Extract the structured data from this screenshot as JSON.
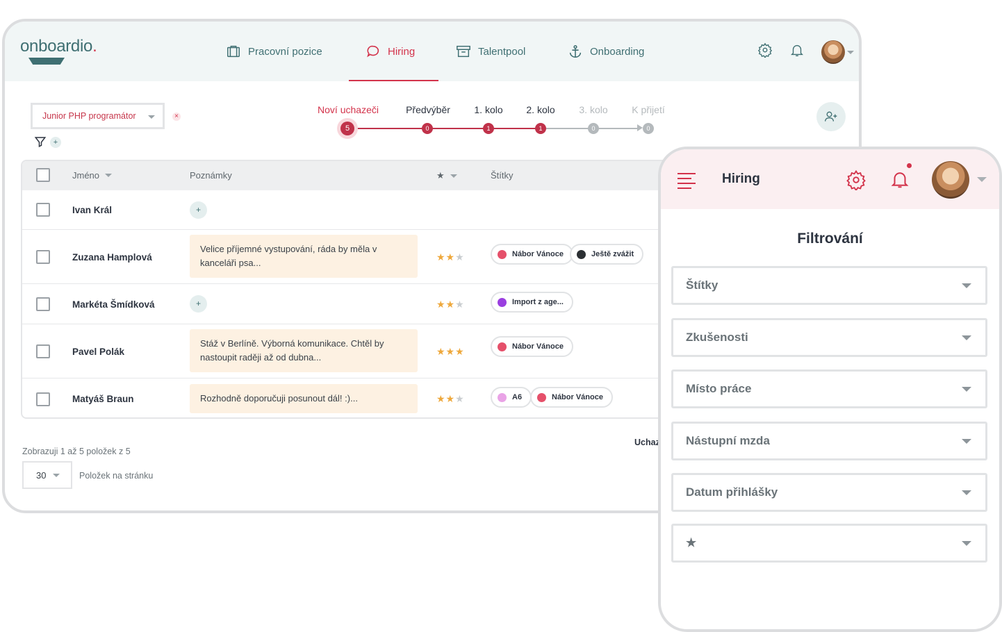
{
  "app": {
    "logo": "onboardio",
    "logo_dot": "."
  },
  "nav": [
    {
      "label": "Pracovní pozice",
      "icon": "briefcase-icon"
    },
    {
      "label": "Hiring",
      "icon": "chat-bubble-icon",
      "active": true
    },
    {
      "label": "Talentpool",
      "icon": "archive-box-icon"
    },
    {
      "label": "Onboarding",
      "icon": "anchor-icon"
    }
  ],
  "filters": {
    "job_position": "Junior PHP programátor",
    "clear": "×",
    "add": "+"
  },
  "stages": [
    {
      "label": "Noví uchazeči",
      "count": "5",
      "state": "active"
    },
    {
      "label": "Předvýběr",
      "count": "0",
      "state": "done"
    },
    {
      "label": "1. kolo",
      "count": "1",
      "state": "done"
    },
    {
      "label": "2. kolo",
      "count": "1",
      "state": "done"
    },
    {
      "label": "3. kolo",
      "count": "0",
      "state": "pending"
    },
    {
      "label": "K přijetí",
      "count": "0",
      "state": "pending"
    }
  ],
  "table": {
    "headers": {
      "name": "Jméno",
      "notes": "Poznámky",
      "rating": "★",
      "tags": "Štítky"
    },
    "rows": [
      {
        "name": "Ivan Král",
        "note": "",
        "rating": 0,
        "tags": []
      },
      {
        "name": "Zuzana Hamplová",
        "note": "Velice příjemné vystupování, ráda by měla v kanceláři psa...",
        "rating": 2,
        "tags": [
          {
            "label": "Nábor Vánoce",
            "color": "#e5506a"
          },
          {
            "label": "Ještě zvážit",
            "color": "#2b2f33"
          }
        ]
      },
      {
        "name": "Markéta Šmídková",
        "note": "",
        "rating": 2,
        "tags": [
          {
            "label": "Import z age...",
            "color": "#9a3fe0"
          }
        ]
      },
      {
        "name": "Pavel Polák",
        "note": "Stáž v Berlíně. Výborná komunikace. Chtěl by nastoupit raději až od dubna...",
        "rating": 3,
        "tags": [
          {
            "label": "Nábor Vánoce",
            "color": "#e5506a"
          }
        ]
      },
      {
        "name": "Matyáš Braun",
        "note": "Rozhodně doporučuji posunout dál! :)...",
        "rating": 2,
        "tags": [
          {
            "label": "A6",
            "color": "#e9a3e6"
          },
          {
            "label": "Nábor Vánoce",
            "color": "#e5506a"
          }
        ]
      }
    ]
  },
  "pagination": {
    "summary": "Zobrazuji 1 až 5 položek z 5",
    "per_page": "30",
    "per_page_label": "Položek na stránku",
    "side_label": "Uchaz"
  },
  "mobile": {
    "title": "Hiring",
    "heading": "Filtrování",
    "filters": [
      "Štítky",
      "Zkušenosti",
      "Místo práce",
      "Nástupní mzda",
      "Datum přihlášky",
      "★"
    ]
  }
}
